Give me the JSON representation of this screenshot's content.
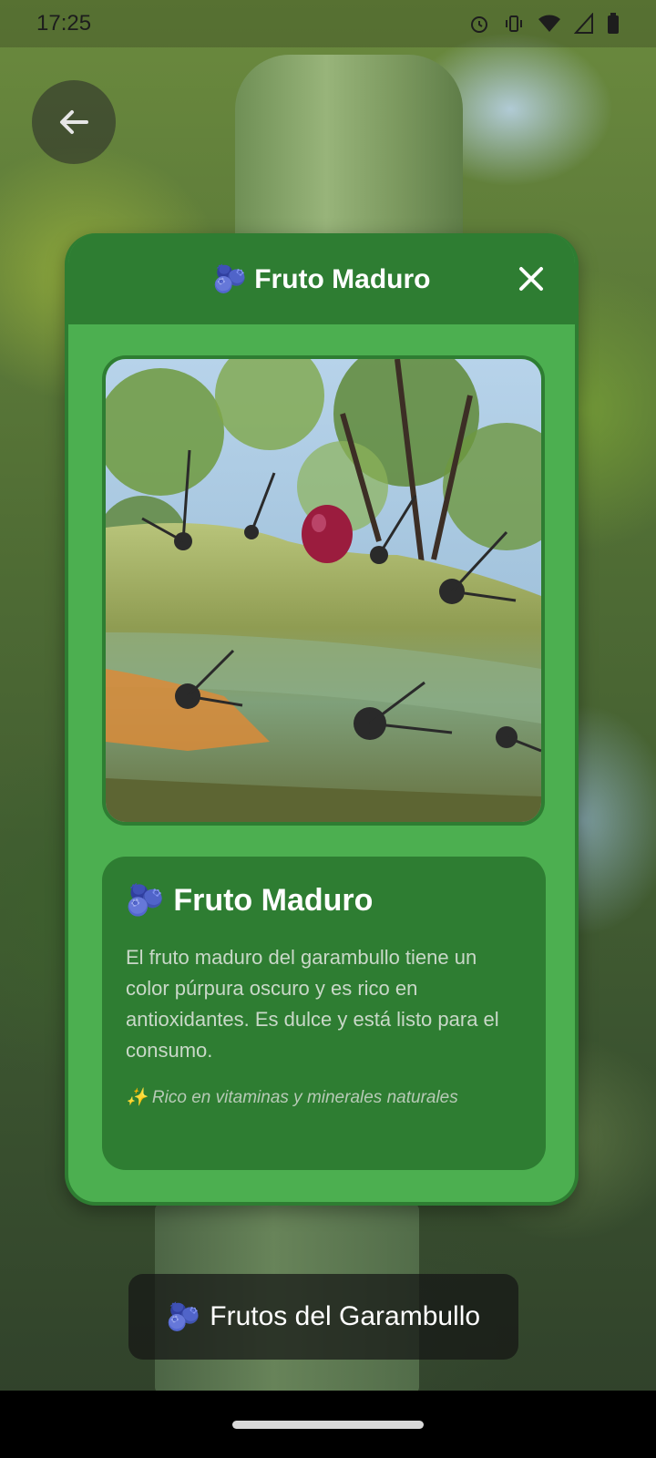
{
  "status_bar": {
    "time": "17:25",
    "icons": [
      "alarm-icon",
      "vibrate-icon",
      "wifi-icon",
      "signal-icon",
      "battery-icon"
    ]
  },
  "back_button": {
    "icon": "arrow-left-icon"
  },
  "modal": {
    "emoji": "🫐",
    "title": "Fruto Maduro",
    "close_icon": "close-icon",
    "colors": {
      "header": "#2e7d32",
      "body": "#4caf50",
      "card": "#2e7d32"
    },
    "card": {
      "emoji": "🫐",
      "title": "Fruto Maduro",
      "description": "El fruto maduro del garambullo tiene un color púrpura oscuro y es rico en antioxidantes. Es dulce y está listo para el consumo.",
      "note": "✨ Rico en vitaminas y minerales naturales"
    }
  },
  "bottom_label": {
    "emoji": "🫐",
    "text": "Frutos del Garambullo"
  }
}
